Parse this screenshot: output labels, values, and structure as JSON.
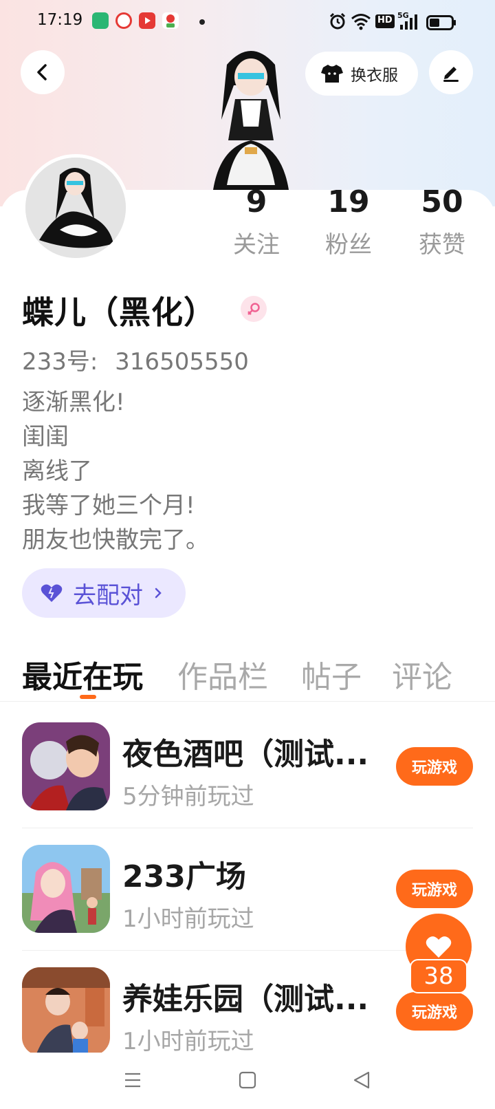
{
  "status_bar": {
    "time": "17:19",
    "hd_label": "HD",
    "network_label": "5G"
  },
  "header": {
    "outfit_button_label": "换衣服"
  },
  "profile": {
    "stats": [
      {
        "value": "9",
        "label": "关注"
      },
      {
        "value": "19",
        "label": "粉丝"
      },
      {
        "value": "50",
        "label": "获赞"
      }
    ],
    "name": "蝶儿（黑化）",
    "id_label": "233号:",
    "id_value": "316505550",
    "bio": [
      "逐渐黑化!",
      "闺闺",
      "离线了",
      "我等了她三个月!",
      "朋友也快散完了。"
    ],
    "match_button_label": "去配对"
  },
  "tabs": [
    {
      "label": "最近在玩",
      "active": true
    },
    {
      "label": "作品栏",
      "active": false
    },
    {
      "label": "帖子",
      "active": false
    },
    {
      "label": "评论",
      "active": false
    }
  ],
  "games": [
    {
      "title": "夜色酒吧（测试...",
      "time": "5分钟前玩过",
      "button": "玩游戏"
    },
    {
      "title": "233广场",
      "time": "1小时前玩过",
      "button": "玩游戏"
    },
    {
      "title": "养娃乐园（测试...",
      "time": "1小时前玩过",
      "button": "玩游戏"
    }
  ],
  "fab": {
    "count": "38"
  },
  "colors": {
    "accent": "#ff6a1a",
    "match_bg": "#ebe8ff",
    "match_text": "#5a52d6"
  }
}
